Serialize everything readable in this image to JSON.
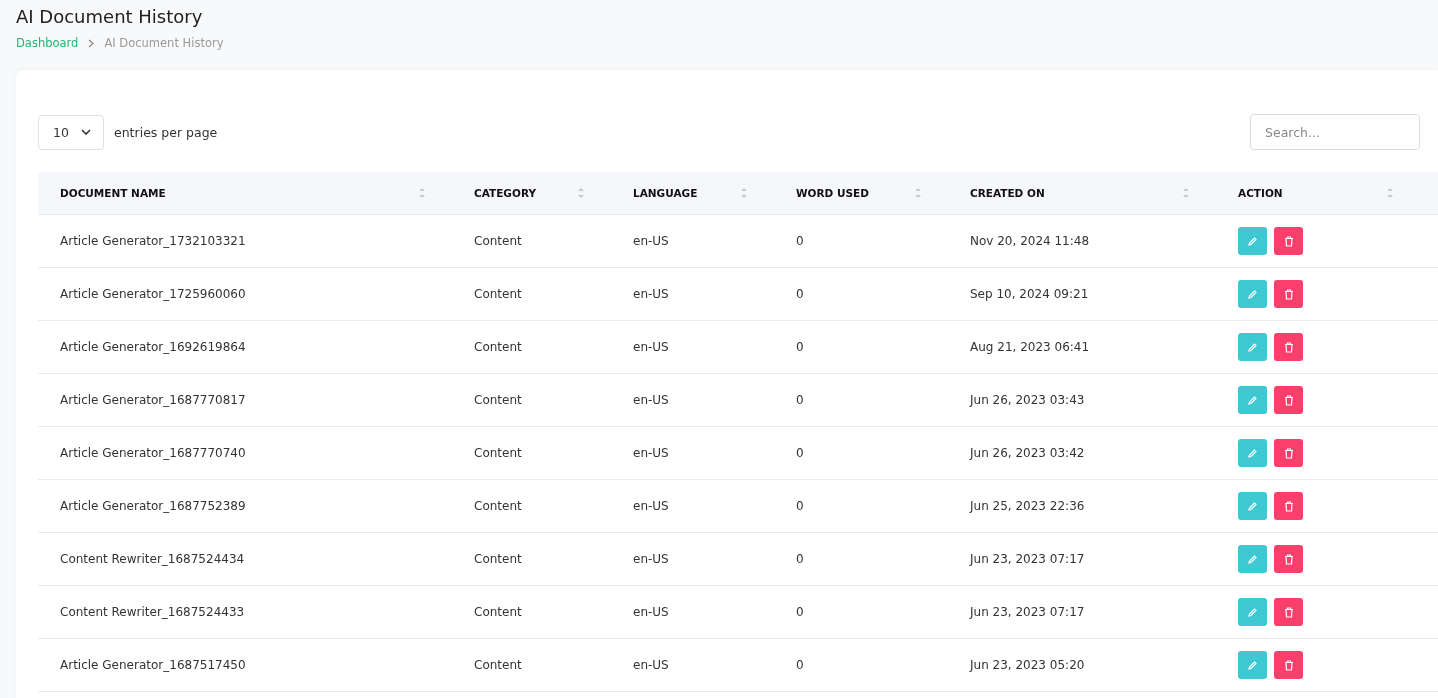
{
  "page": {
    "title": "AI Document History"
  },
  "breadcrumb": [
    {
      "label": "Dashboard",
      "kind": "link"
    },
    {
      "label": "AI Document History",
      "kind": "current"
    }
  ],
  "page_size": {
    "value": "10",
    "label": "entries per page"
  },
  "search": {
    "placeholder": "Search..."
  },
  "table": {
    "columns": [
      "DOCUMENT NAME",
      "CATEGORY",
      "LANGUAGE",
      "WORD USED",
      "CREATED ON",
      "ACTION"
    ],
    "rows": [
      {
        "name": "Article Generator_1732103321",
        "category": "Content",
        "language": "en-US",
        "words": "0",
        "created": "Nov 20, 2024 11:48"
      },
      {
        "name": "Article Generator_1725960060",
        "category": "Content",
        "language": "en-US",
        "words": "0",
        "created": "Sep 10, 2024 09:21"
      },
      {
        "name": "Article Generator_1692619864",
        "category": "Content",
        "language": "en-US",
        "words": "0",
        "created": "Aug 21, 2023 06:41"
      },
      {
        "name": "Article Generator_1687770817",
        "category": "Content",
        "language": "en-US",
        "words": "0",
        "created": "Jun 26, 2023 03:43"
      },
      {
        "name": "Article Generator_1687770740",
        "category": "Content",
        "language": "en-US",
        "words": "0",
        "created": "Jun 26, 2023 03:42"
      },
      {
        "name": "Article Generator_1687752389",
        "category": "Content",
        "language": "en-US",
        "words": "0",
        "created": "Jun 25, 2023 22:36"
      },
      {
        "name": "Content Rewriter_1687524434",
        "category": "Content",
        "language": "en-US",
        "words": "0",
        "created": "Jun 23, 2023 07:17"
      },
      {
        "name": "Content Rewriter_1687524433",
        "category": "Content",
        "language": "en-US",
        "words": "0",
        "created": "Jun 23, 2023 07:17"
      },
      {
        "name": "Article Generator_1687517450",
        "category": "Content",
        "language": "en-US",
        "words": "0",
        "created": "Jun 23, 2023 05:20"
      }
    ]
  }
}
